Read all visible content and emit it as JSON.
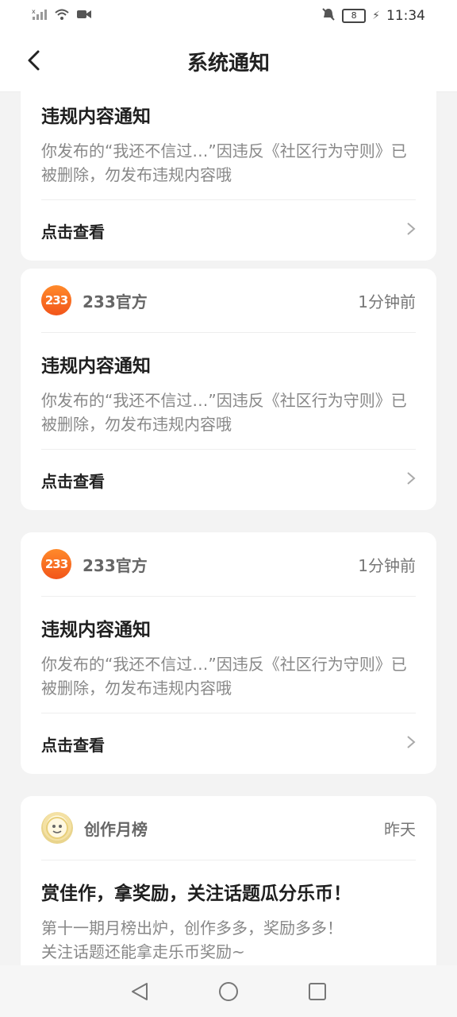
{
  "status_bar": {
    "battery": "8",
    "time": "11:34"
  },
  "nav": {
    "title": "系统通知"
  },
  "cards": [
    {
      "title": "违规内容通知",
      "body": "你发布的“我还不信过…”因违反《社区行为守则》已被删除，勿发布违规内容哦",
      "link": "点击查看"
    },
    {
      "sender": "233官方",
      "logo_text": "233",
      "time": "1分钟前",
      "title": "违规内容通知",
      "body": "你发布的“我还不信过…”因违反《社区行为守则》已被删除，勿发布违规内容哦",
      "link": "点击查看"
    },
    {
      "sender": "233官方",
      "logo_text": "233",
      "time": "1分钟前",
      "title": "违规内容通知",
      "body": "你发布的“我还不信过…”因违反《社区行为守则》已被删除，勿发布违规内容哦",
      "link": "点击查看"
    },
    {
      "sender": "创作月榜",
      "time": "昨天",
      "title": "赏佳作，拿奖励，关注话题瓜分乐币！",
      "body_line1": "第十一期月榜出炉，创作多多，奖励多多！",
      "body_line2": "关注话题还能拿走乐币奖励~"
    }
  ]
}
